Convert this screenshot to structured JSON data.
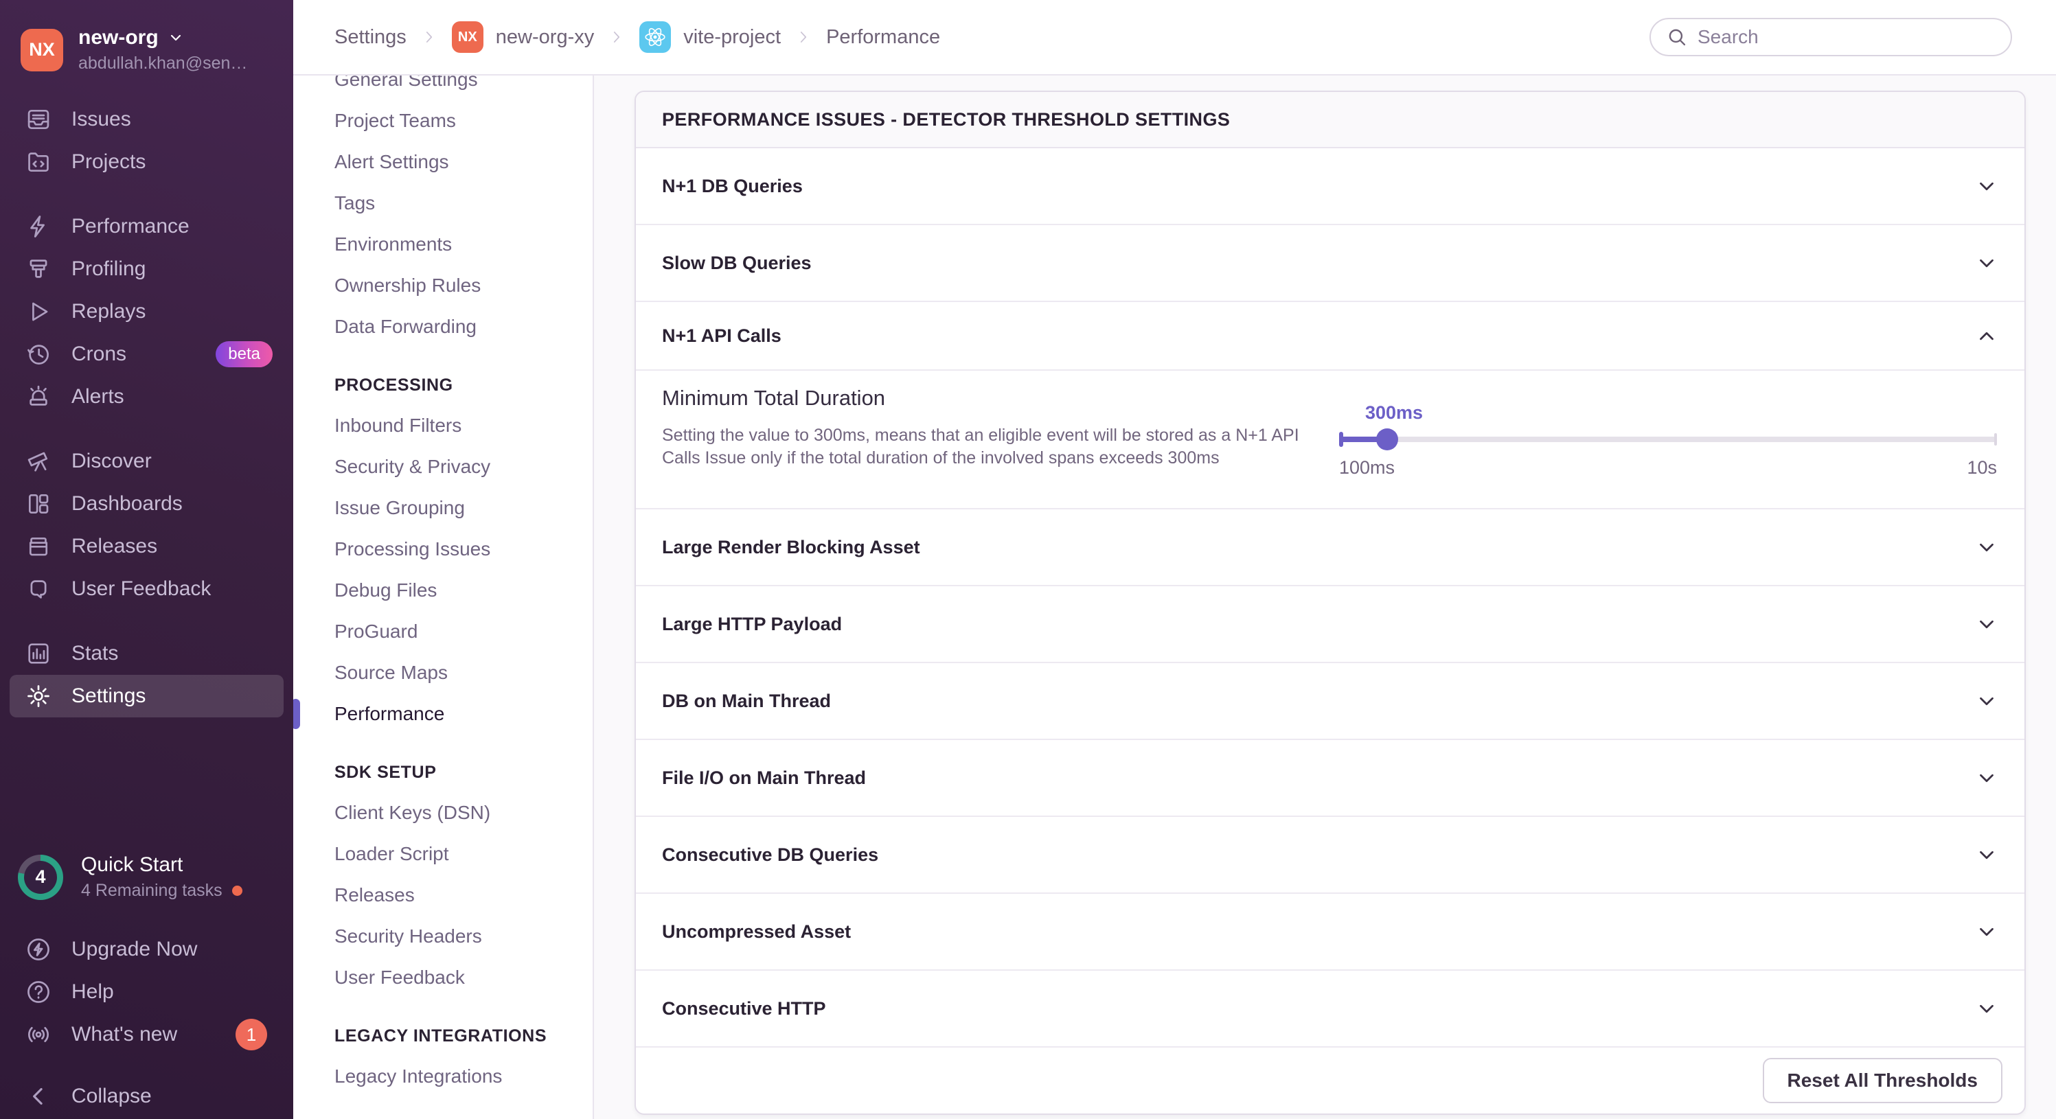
{
  "colors": {
    "accent_purple": "#6C5FC7",
    "sidebar_gradient_top": "#452650",
    "sidebar_gradient_bottom": "#2f1937",
    "org_avatar_red": "#EE6A4F",
    "react_blue": "#5CC8EF",
    "progress_green": "#2BA185",
    "badge_red": "#EF6A5A",
    "content_bg": "#FAF9FB",
    "panel_border": "#E2DCE8"
  },
  "sidebar": {
    "org_initials": "NX",
    "org_name": "new-org",
    "org_email": "abdullah.khan@sen…",
    "items_main": [
      {
        "label": "Issues"
      },
      {
        "label": "Projects"
      }
    ],
    "items_perf": [
      {
        "label": "Performance"
      },
      {
        "label": "Profiling"
      },
      {
        "label": "Replays"
      },
      {
        "label": "Crons",
        "badge": "beta"
      },
      {
        "label": "Alerts"
      }
    ],
    "items_insights": [
      {
        "label": "Discover"
      },
      {
        "label": "Dashboards"
      },
      {
        "label": "Releases"
      },
      {
        "label": "User Feedback"
      }
    ],
    "items_bottom": [
      {
        "label": "Stats"
      },
      {
        "label": "Settings"
      }
    ],
    "quick_start": {
      "title": "Quick Start",
      "subtitle": "4 Remaining tasks",
      "progress_count": "4"
    },
    "footer_items": [
      {
        "label": "Upgrade Now"
      },
      {
        "label": "Help"
      },
      {
        "label": "What's new",
        "badge": "1"
      }
    ],
    "collapse_label": "Collapse"
  },
  "header": {
    "breadcrumbs": {
      "settings": "Settings",
      "org": "new-org-xy",
      "org_initials": "NX",
      "project": "vite-project",
      "page": "Performance"
    },
    "search_placeholder": "Search"
  },
  "secondary_nav": {
    "top_items": [
      "General Settings",
      "Project Teams",
      "Alert Settings",
      "Tags",
      "Environments",
      "Ownership Rules",
      "Data Forwarding"
    ],
    "processing_header": "PROCESSING",
    "processing_items": [
      "Inbound Filters",
      "Security & Privacy",
      "Issue Grouping",
      "Processing Issues",
      "Debug Files",
      "ProGuard",
      "Source Maps",
      "Performance"
    ],
    "active_item": "Performance",
    "sdk_header": "SDK SETUP",
    "sdk_items": [
      "Client Keys (DSN)",
      "Loader Script",
      "Releases",
      "Security Headers",
      "User Feedback"
    ],
    "legacy_header": "LEGACY INTEGRATIONS",
    "legacy_items": [
      "Legacy Integrations"
    ]
  },
  "panel": {
    "title": "PERFORMANCE ISSUES - DETECTOR THRESHOLD SETTINGS",
    "rows": [
      "N+1 DB Queries",
      "Slow DB Queries",
      "N+1 API Calls",
      "Large Render Blocking Asset",
      "Large HTTP Payload",
      "DB on Main Thread",
      "File I/O on Main Thread",
      "Consecutive DB Queries",
      "Uncompressed Asset",
      "Consecutive HTTP"
    ],
    "expanded_row": "N+1 API Calls",
    "detail": {
      "title": "Minimum Total Duration",
      "description": "Setting the value to 300ms, means that an eligible event will be stored as a N+1 API Calls Issue only if the total duration of the involved spans exceeds 300ms",
      "slider": {
        "value_label": "300ms",
        "min_label": "100ms",
        "max_label": "10s",
        "percent": 7.3
      }
    },
    "reset_button_label": "Reset All Thresholds"
  }
}
